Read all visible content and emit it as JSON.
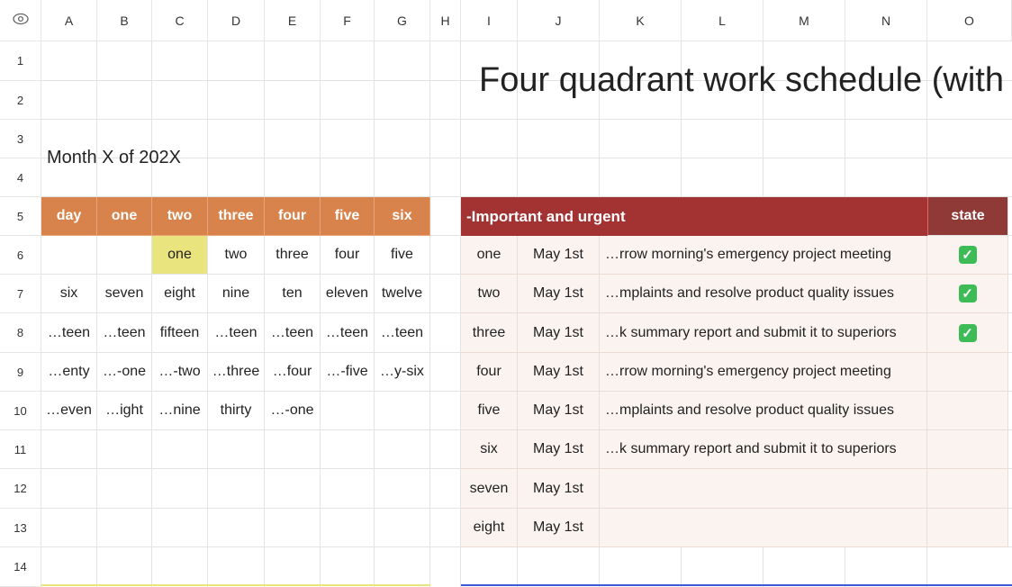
{
  "columns": [
    "A",
    "B",
    "C",
    "D",
    "E",
    "F",
    "G",
    "H",
    "I",
    "J",
    "K",
    "L",
    "M",
    "N",
    "O"
  ],
  "rows": [
    "1",
    "2",
    "3",
    "4",
    "5",
    "6",
    "7",
    "8",
    "9",
    "10",
    "11",
    "12",
    "13",
    "14"
  ],
  "title": "Four quadrant work schedule (with",
  "month_label": "Month X of 202X",
  "calendar": {
    "headers": [
      "day",
      "one",
      "two",
      "three",
      "four",
      "five",
      "six"
    ],
    "rows": [
      [
        "",
        "",
        "one",
        "two",
        "three",
        "four",
        "five"
      ],
      [
        "six",
        "seven",
        "eight",
        "nine",
        "ten",
        "eleven",
        "twelve"
      ],
      [
        "…teen",
        "…teen",
        "fifteen",
        "…teen",
        "…teen",
        "…teen",
        "…teen"
      ],
      [
        "…enty",
        "…-one",
        "…-two",
        "…three",
        "…four",
        "…-five",
        "…y-six"
      ],
      [
        "…even",
        "…ight",
        "…nine",
        "thirty",
        "…-one",
        "",
        ""
      ]
    ]
  },
  "quadrant": {
    "title": "-Important and urgent",
    "state_header": "state",
    "items": [
      {
        "label": "one",
        "date": "May 1st",
        "task": "…rrow morning's emergency project meeting",
        "done": true
      },
      {
        "label": "two",
        "date": "May 1st",
        "task": "…mplaints and resolve product quality issues",
        "done": true
      },
      {
        "label": "three",
        "date": "May 1st",
        "task": "…k summary report and submit it to superiors",
        "done": true
      },
      {
        "label": "four",
        "date": "May 1st",
        "task": "…rrow morning's emergency project meeting",
        "done": false
      },
      {
        "label": "five",
        "date": "May 1st",
        "task": "…mplaints and resolve product quality issues",
        "done": false
      },
      {
        "label": "six",
        "date": "May 1st",
        "task": "…k summary report and submit it to superiors",
        "done": false
      },
      {
        "label": "seven",
        "date": "May 1st",
        "task": "",
        "done": false
      },
      {
        "label": "eight",
        "date": "May 1st",
        "task": "",
        "done": false
      }
    ]
  },
  "colors": {
    "calendar_header": "#D9834C",
    "highlight": "#EAE47E",
    "quadrant_header": "#A33232",
    "state_header": "#8F3A36",
    "check": "#3DBB57"
  },
  "icons": {
    "corner": "eye-icon",
    "done": "checkmark-icon"
  }
}
